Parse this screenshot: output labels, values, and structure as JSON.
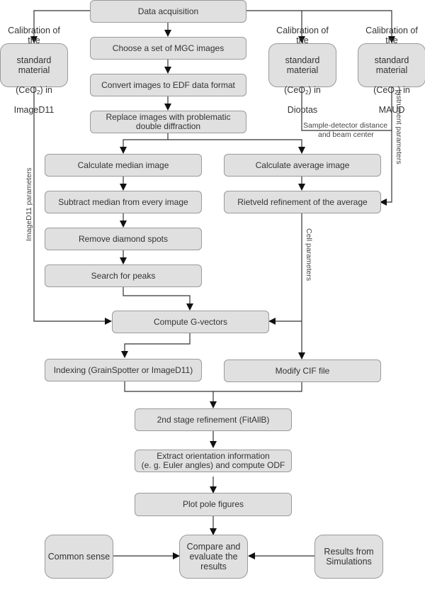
{
  "diagram": {
    "nodes": {
      "data_acquisition": "Data acquisition",
      "choose_images": "Choose a set of MGC images",
      "convert_edf": "Convert images to EDF data format",
      "replace_images": "Replace images with problematic\ndouble diffraction",
      "calc_median": "Calculate median image",
      "subtract_median": "Subtract median from every image",
      "remove_diamond": "Remove diamond spots",
      "search_peaks": "Search for peaks",
      "calc_average": "Calculate average image",
      "rietveld": "Rietveld refinement of the average",
      "compute_gvectors": "Compute G-vectors",
      "indexing": "Indexing (GrainSpotter or ImageD11)",
      "modify_cif": "Modify CIF file",
      "second_stage": "2nd stage refinement (FitAllB)",
      "extract_orientation": "Extract orientation information\n(e. g. Euler angles) and compute ODF",
      "plot_pole": "Plot pole figures",
      "compare_evaluate": "Compare and\nevaluate the\nresults",
      "common_sense": "Common sense",
      "results_simulations": "Results from\nSimulations"
    },
    "calibration": {
      "line1": "Calibration of the",
      "line2": "standard material",
      "line3_prefix": "(CeO",
      "line3_sub": "2",
      "line3_suffix": ") in",
      "imaged11": "ImageD11",
      "dioptas": "Dioptas",
      "maud": "MAUD"
    },
    "edge_labels": {
      "imaged11_params": "ImageD11 parameters",
      "sample_detector": "Sample-detector distance",
      "beam_center": "and beam center",
      "instrument_params": "Instrument parameters",
      "cell_params": "Cell parameters"
    },
    "colors": {
      "box_fill": "#e0e0e0",
      "box_border": "#9a9a9a",
      "line": "#333333"
    }
  }
}
